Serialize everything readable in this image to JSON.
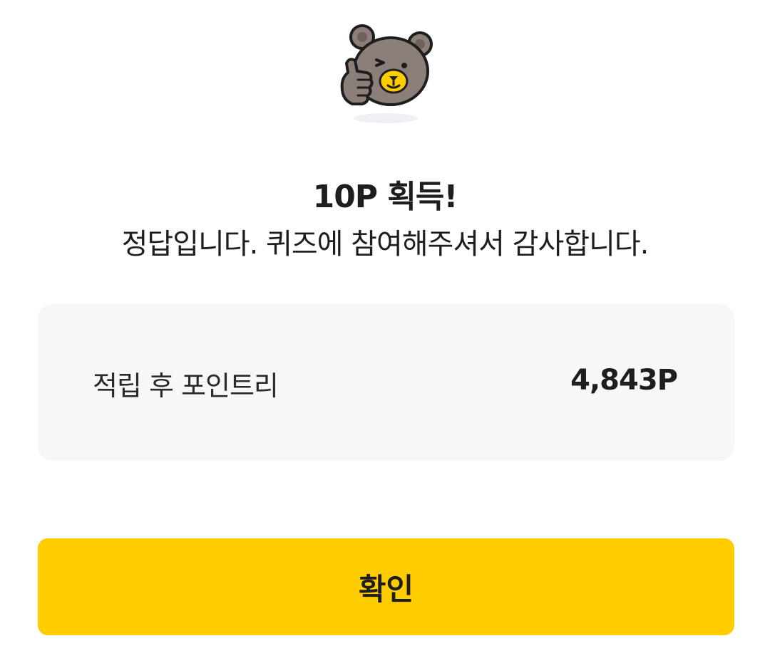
{
  "header": {
    "mascot_icon": "bear-thumbs-up-icon",
    "title": "10P 획득!",
    "subtitle": "정답입니다. 퀴즈에 참여해주셔서 감사합니다."
  },
  "points_card": {
    "label": "적립 후 포인트리",
    "value": "4,843P"
  },
  "confirm_button": {
    "label": "확인"
  },
  "colors": {
    "accent": "#ffcc00",
    "card_background": "#f7f7f8",
    "text": "#1e1e1e",
    "bear_brown": "#8c7f79"
  }
}
